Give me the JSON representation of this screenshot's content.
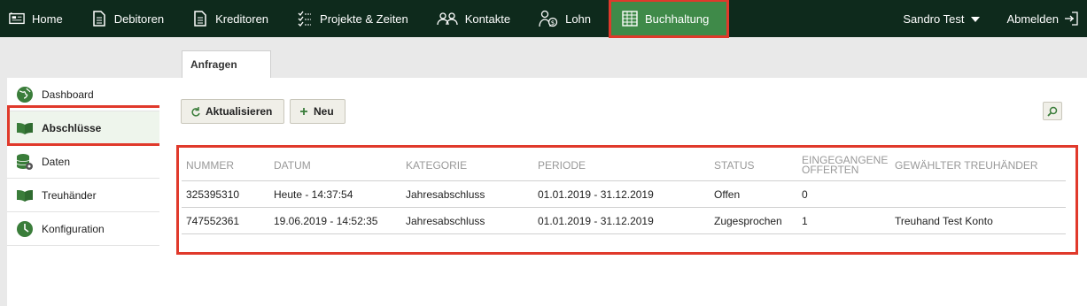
{
  "nav": {
    "items": [
      {
        "label": "Home",
        "icon": "home-icon"
      },
      {
        "label": "Debitoren",
        "icon": "document-icon"
      },
      {
        "label": "Kreditoren",
        "icon": "document-icon"
      },
      {
        "label": "Projekte & Zeiten",
        "icon": "checklist-icon"
      },
      {
        "label": "Kontakte",
        "icon": "people-icon"
      },
      {
        "label": "Lohn",
        "icon": "payroll-icon"
      },
      {
        "label": "Buchhaltung",
        "icon": "ledger-icon"
      }
    ],
    "active": "Buchhaltung",
    "user": "Sandro Test",
    "logout": "Abmelden"
  },
  "tabs": [
    {
      "label": "Anfragen"
    }
  ],
  "sidebar": {
    "items": [
      {
        "label": "Dashboard",
        "icon": "globe-icon"
      },
      {
        "label": "Abschlüsse",
        "icon": "book-icon"
      },
      {
        "label": "Daten",
        "icon": "database-icon"
      },
      {
        "label": "Treuhänder",
        "icon": "book-icon"
      },
      {
        "label": "Konfiguration",
        "icon": "clock-icon"
      }
    ],
    "active": "Abschlüsse"
  },
  "toolbar": {
    "refresh_label": "Aktualisieren",
    "new_label": "Neu"
  },
  "table": {
    "columns": [
      "NUMMER",
      "DATUM",
      "KATEGORIE",
      "PERIODE",
      "STATUS",
      "EINGEGANGENE OFFERTEN",
      "GEWÄHLTER TREUHÄNDER"
    ],
    "rows": [
      [
        "325395310",
        "Heute - 14:37:54",
        "Jahresabschluss",
        "01.01.2019 - 31.12.2019",
        "Offen",
        "0",
        ""
      ],
      [
        "747552361",
        "19.06.2019 - 14:52:35",
        "Jahresabschluss",
        "01.01.2019 - 31.12.2019",
        "Zugesprochen",
        "1",
        "Treuhand Test Konto"
      ]
    ]
  },
  "colors": {
    "topbar": "#0e2a1c",
    "active_nav": "#3f8a49",
    "highlight": "#e0392b",
    "icon_green": "#3a7d3a"
  }
}
